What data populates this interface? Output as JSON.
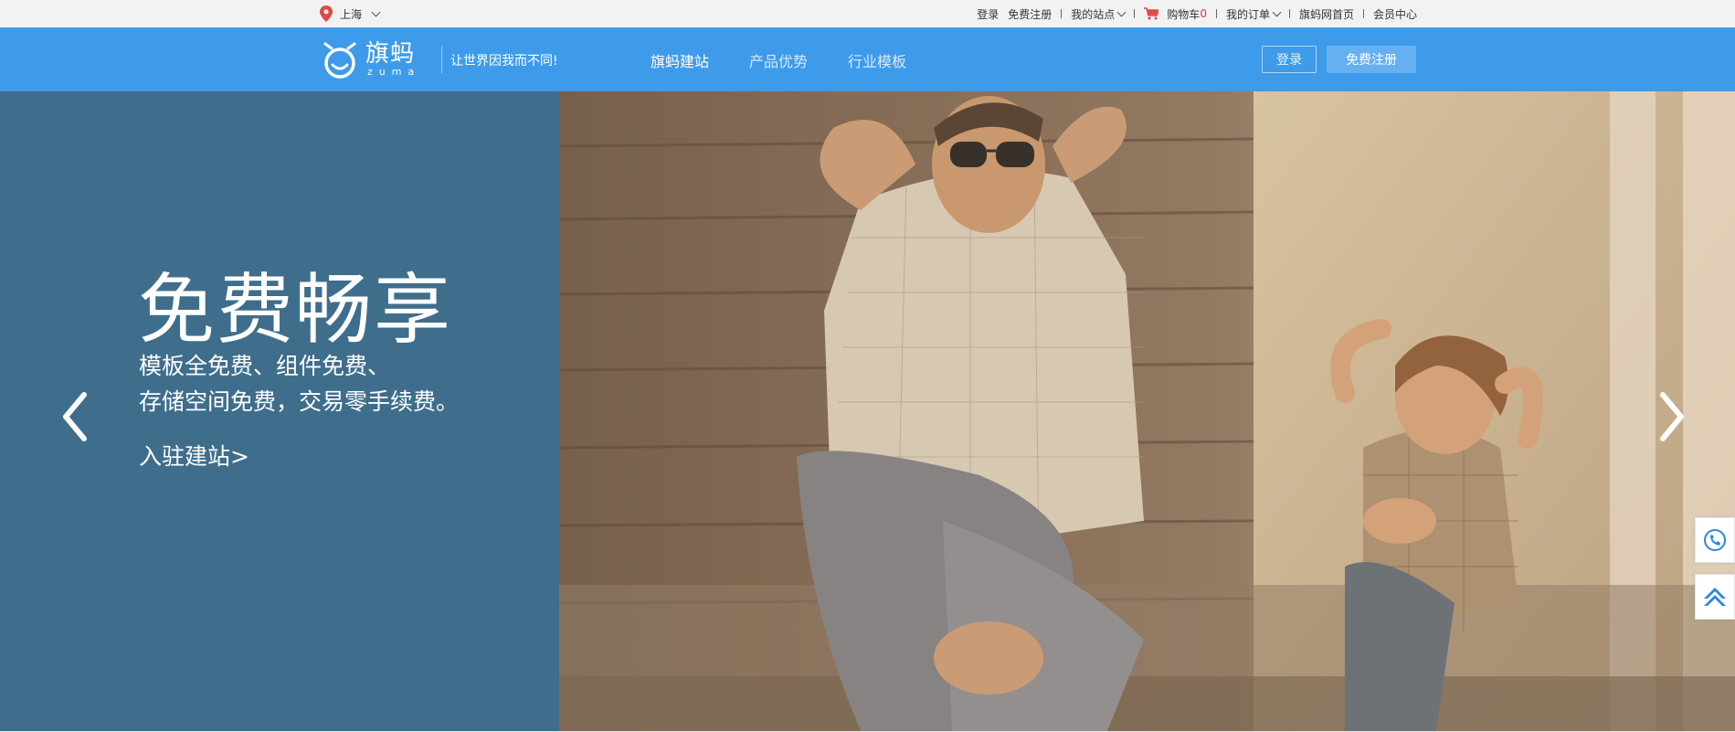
{
  "topbar": {
    "location": "上海",
    "links": [
      {
        "label": "登录"
      },
      {
        "label": "免费注册"
      },
      {
        "label": "我的站点"
      },
      {
        "label": "购物车",
        "count": "0"
      },
      {
        "label": "我的订单"
      },
      {
        "label": "旗蚂网首页"
      },
      {
        "label": "会员中心"
      }
    ]
  },
  "header": {
    "logo_cn": "旗蚂",
    "logo_en": "zuma",
    "slogan": "让世界因我而不同!",
    "nav": [
      {
        "label": "旗蚂建站",
        "active": true
      },
      {
        "label": "产品优势",
        "active": false
      },
      {
        "label": "行业模板",
        "active": false
      }
    ],
    "login_label": "登录",
    "register_label": "免费注册"
  },
  "banner": {
    "headline": "免费畅享",
    "subline1": "模板全免费、组件免费、",
    "subline2": "存储空间免费，交易零手续费。",
    "cta": "入驻建站>"
  },
  "icons": {
    "location": "map-pin-icon",
    "cart": "cart-icon",
    "phone": "phone-icon",
    "back_to_top": "chevron-up-icon"
  },
  "colors": {
    "header_blue": "#3d9bea",
    "banner_panel": "#3e6e8c",
    "accent_red": "#e23b3b",
    "register_button": "#66b0f1"
  }
}
